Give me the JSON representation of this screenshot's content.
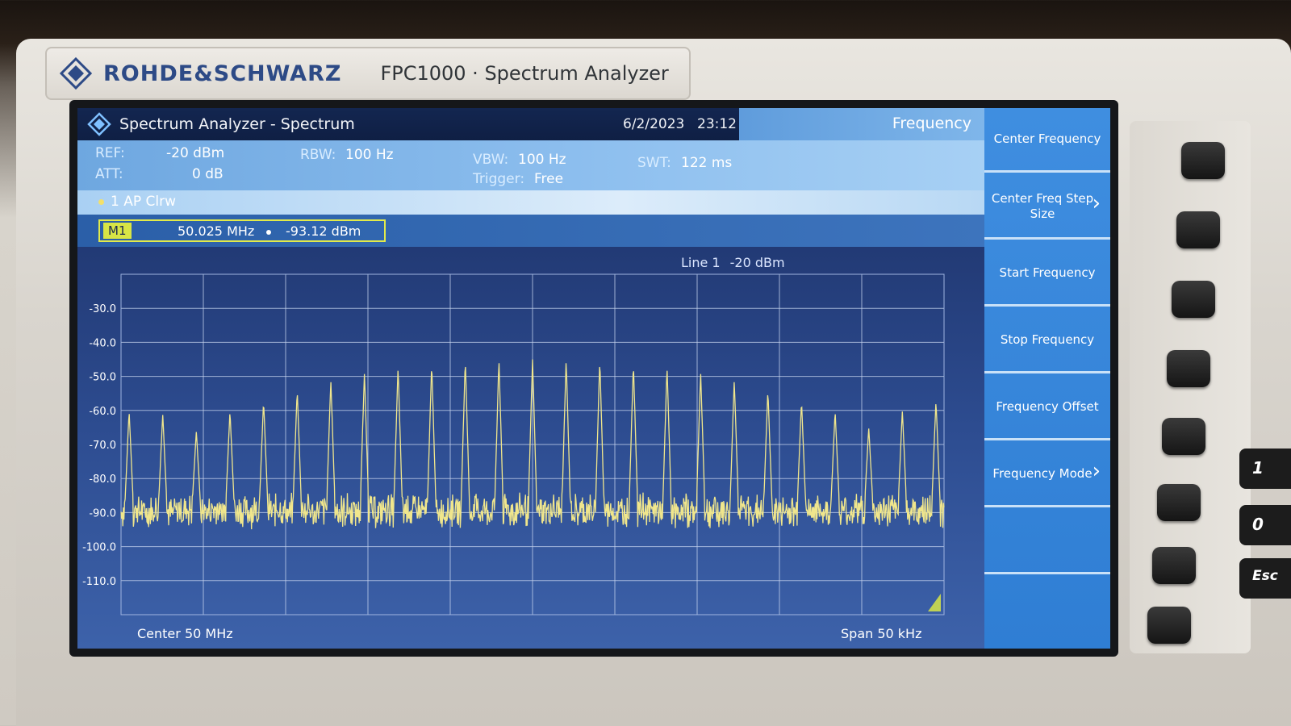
{
  "device": {
    "brand": "ROHDE&SCHWARZ",
    "model": "FPC1000 · Spectrum Analyzer"
  },
  "titlebar": {
    "title": "Spectrum Analyzer - Spectrum",
    "date": "6/2/2023",
    "time": "23:12",
    "menu": "Frequency"
  },
  "settings": {
    "ref_label": "REF:",
    "ref_value": "-20 dBm",
    "att_label": "ATT:",
    "att_value": "0 dB",
    "rbw_label": "RBW:",
    "rbw_value": "100 Hz",
    "vbw_label": "VBW:",
    "vbw_value": "100 Hz",
    "trigger_label": "Trigger:",
    "trigger_value": "Free",
    "swt_label": "SWT:",
    "swt_value": "122 ms"
  },
  "trace": {
    "label": "1 AP Clrw"
  },
  "marker": {
    "tag": "M1",
    "frequency": "50.025 MHz",
    "level": "-93.12 dBm"
  },
  "line1": {
    "label": "Line 1",
    "value": "-20 dBm"
  },
  "footer": {
    "center": "Center 50 MHz",
    "span": "Span 50 kHz"
  },
  "softkeys": [
    {
      "label": "Center Frequency",
      "submenu": false
    },
    {
      "label": "Center Freq Step Size",
      "submenu": true
    },
    {
      "label": "Start Frequency",
      "submenu": false
    },
    {
      "label": "Stop Frequency",
      "submenu": false
    },
    {
      "label": "Frequency Offset",
      "submenu": false
    },
    {
      "label": "Frequency Mode",
      "submenu": true
    },
    {
      "label": "",
      "submenu": false
    },
    {
      "label": "",
      "submenu": false
    }
  ],
  "side_keys": [
    "1",
    "0",
    "Esc"
  ],
  "colors": {
    "trace": "#f0e68c",
    "grid": "#c8d6f0",
    "accent": "#3f8ee0",
    "marker_box": "#e2ea4a"
  },
  "chart_data": {
    "type": "line",
    "y_ticks": [
      "-30.0",
      "-40.0",
      "-50.0",
      "-60.0",
      "-70.0",
      "-80.0",
      "-90.0",
      "-100.0",
      "-110.0"
    ],
    "ylim": [
      -120,
      -20
    ],
    "x_center": "Center 50 MHz",
    "x_span": "Span 50 kHz",
    "noise_floor_dbm": -88,
    "peaks_dbm": [
      -60,
      -61,
      -66,
      -60,
      -57,
      -54,
      -51,
      -49,
      -47,
      -46,
      -45,
      -45,
      -45,
      -45,
      -45,
      -46,
      -47,
      -49,
      -51,
      -54,
      -57,
      -60,
      -65,
      -60,
      -57
    ]
  }
}
